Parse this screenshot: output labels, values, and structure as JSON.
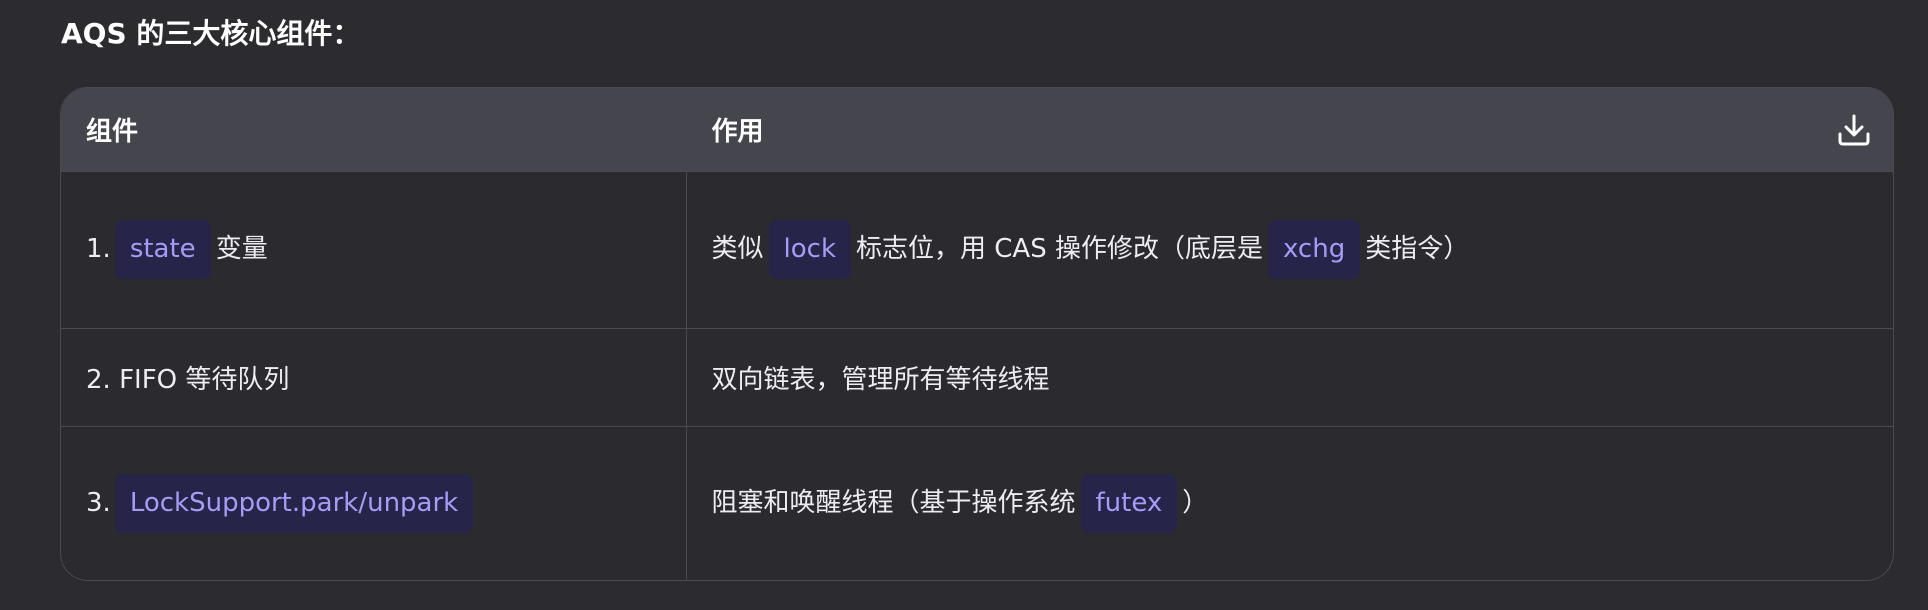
{
  "heading": "AQS 的三大核心组件：",
  "table": {
    "headers": [
      "组件",
      "作用"
    ],
    "rows": [
      {
        "component": {
          "prefix": "1.",
          "code": "state",
          "suffix": "变量"
        },
        "purpose": {
          "part1": "类似",
          "code1": "lock",
          "part2": "标志位，用 CAS 操作修改（底层是",
          "code2": "xchg",
          "part3": "类指令）"
        }
      },
      {
        "component": {
          "text": "2. FIFO 等待队列"
        },
        "purpose": {
          "text": "双向链表，管理所有等待线程"
        }
      },
      {
        "component": {
          "prefix": "3.",
          "code": "LockSupport.park/unpark"
        },
        "purpose": {
          "part1": "阻塞和唤醒线程（基于操作系统",
          "code1": "futex",
          "part2": "）"
        }
      }
    ],
    "download_icon": "download-icon"
  },
  "colors": {
    "background": "#2b2b30",
    "header_bg": "#44454d",
    "code_bg": "#27244a",
    "code_text": "#a59df5"
  }
}
